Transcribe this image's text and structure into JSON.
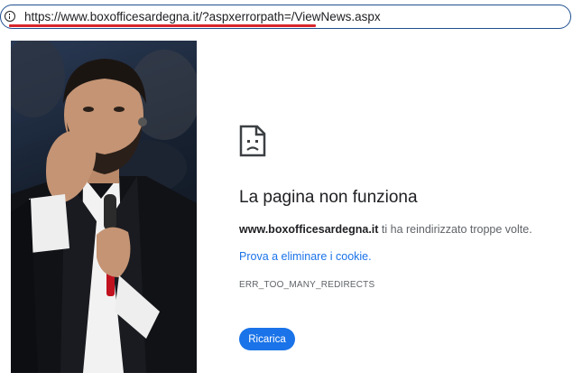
{
  "browser": {
    "url": "https://www.boxofficesardegna.it/?aspxerrorpath=/ViewNews.aspx",
    "info_icon": "info-icon"
  },
  "photo": {
    "subject": "photo-performer"
  },
  "error": {
    "icon": "sad-page-icon",
    "title": "La pagina non funziona",
    "domain": "www.boxofficesardegna.it",
    "message": " ti ha reindirizzato troppe volte.",
    "suggestion_link": "Prova a eliminare i cookie",
    "suggestion_end": ".",
    "code": "ERR_TOO_MANY_REDIRECTS",
    "reload_label": "Ricarica"
  },
  "colors": {
    "accent": "#1a73e8",
    "underline": "#d7262c",
    "address_border": "#1f4f8f"
  }
}
